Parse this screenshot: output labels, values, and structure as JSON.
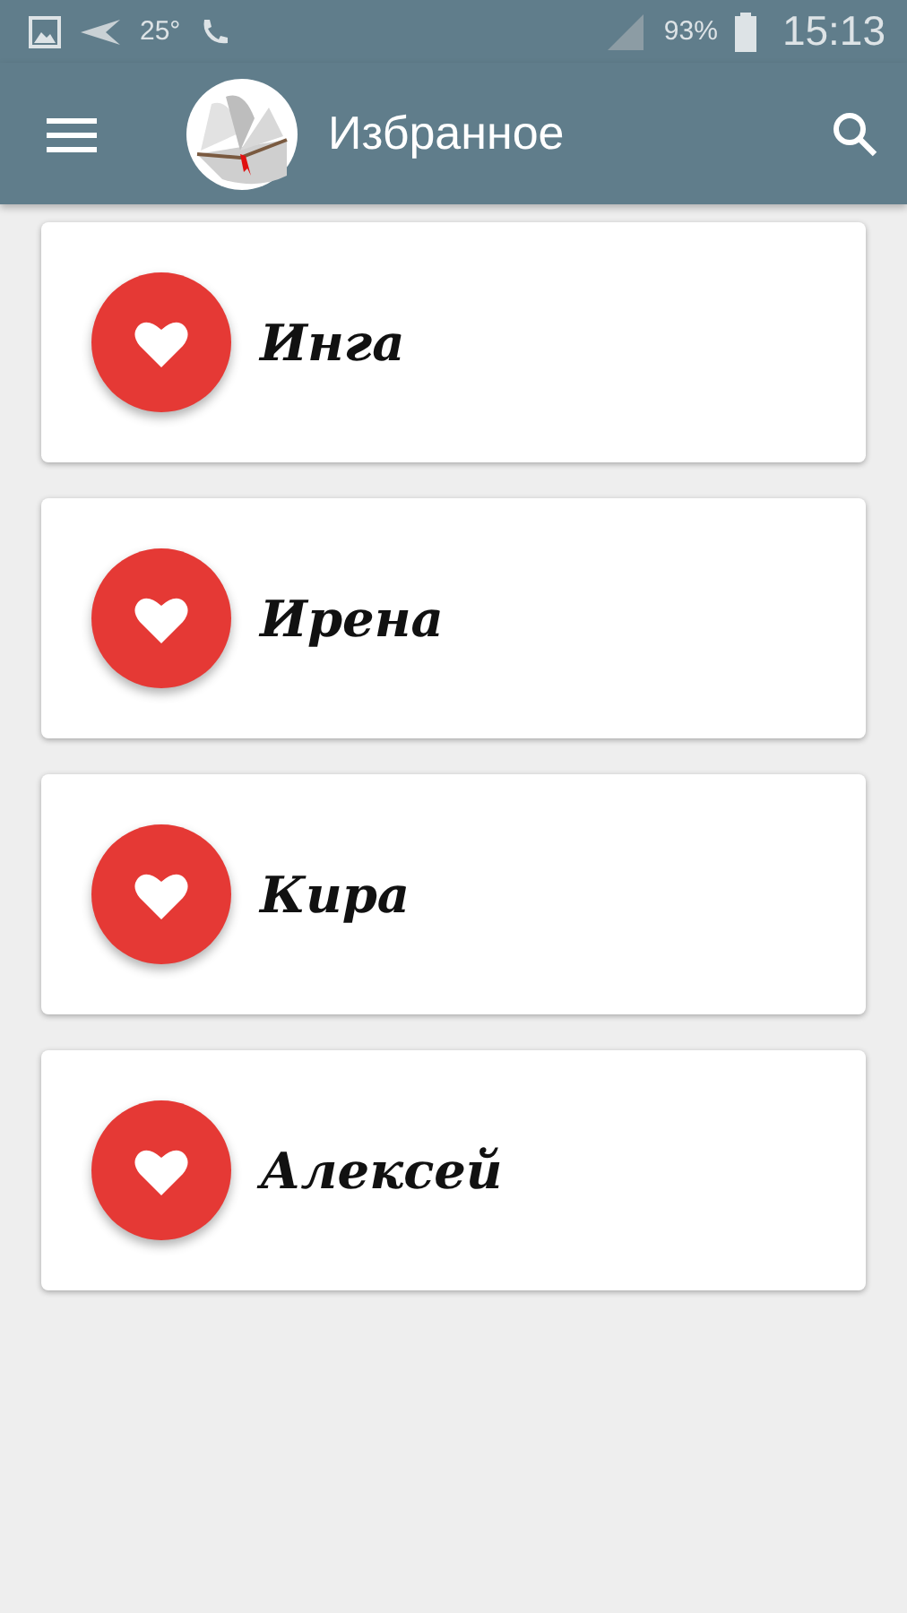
{
  "status_bar": {
    "temperature": "25°",
    "battery": "93%",
    "time": "15:13"
  },
  "app_bar": {
    "title": "Избранное"
  },
  "favorites": [
    {
      "name": "Инга"
    },
    {
      "name": "Ирена"
    },
    {
      "name": "Кира"
    },
    {
      "name": "Алексей"
    }
  ]
}
